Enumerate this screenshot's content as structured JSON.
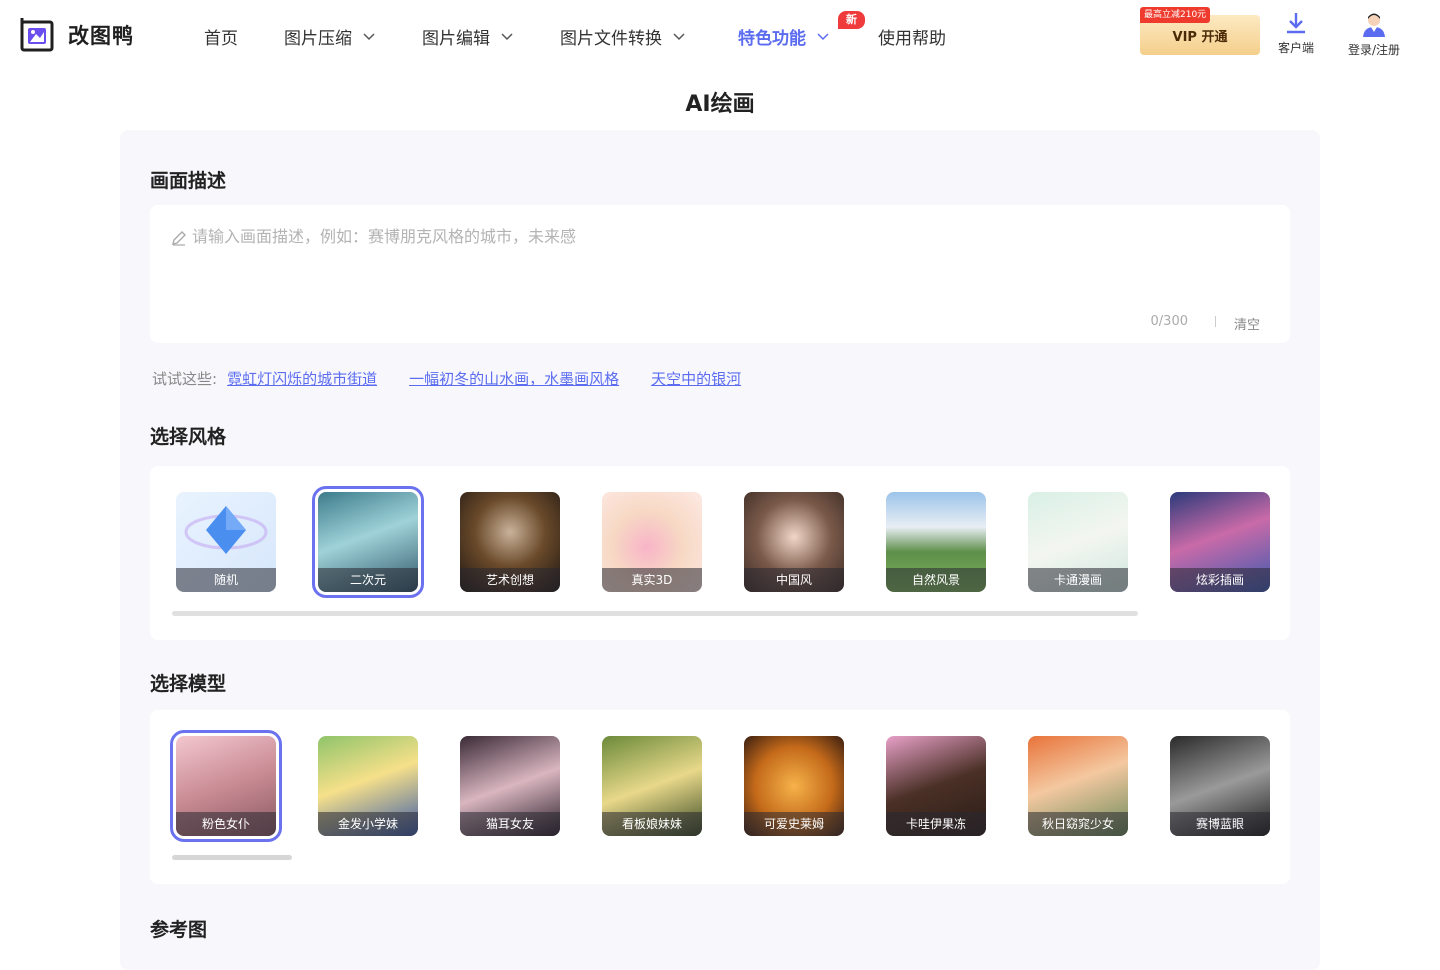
{
  "header": {
    "logo_text": "改图鸭",
    "nav": [
      {
        "label": "首页",
        "dropdown": false
      },
      {
        "label": "图片压缩",
        "dropdown": true
      },
      {
        "label": "图片编辑",
        "dropdown": true
      },
      {
        "label": "图片文件转换",
        "dropdown": true
      },
      {
        "label": "特色功能",
        "dropdown": true,
        "badge": "新",
        "active": true
      },
      {
        "label": "使用帮助",
        "dropdown": false
      }
    ],
    "vip_tag": "最高立减210元",
    "vip_label": "VIP 开通",
    "client_label": "客户端",
    "login_label": "登录/注册"
  },
  "page": {
    "title": "AI绘画",
    "description_section": "画面描述",
    "description_placeholder": "请输入画面描述，例如：赛博朋克风格的城市，未来感",
    "counter": "0/300",
    "clear_label": "清空",
    "try_label": "试试这些:",
    "suggestions": [
      "霓虹灯闪烁的城市街道",
      "一幅初冬的山水画，水墨画风格",
      "天空中的银河"
    ],
    "style_section": "选择风格",
    "styles": [
      {
        "label": "随机",
        "icon": "diamond-icon"
      },
      {
        "label": "二次元",
        "selected": true
      },
      {
        "label": "艺术创想"
      },
      {
        "label": "真实3D"
      },
      {
        "label": "中国风"
      },
      {
        "label": "自然风景"
      },
      {
        "label": "卡通漫画"
      },
      {
        "label": "炫彩插画"
      }
    ],
    "model_section": "选择模型",
    "models": [
      {
        "label": "粉色女仆",
        "selected": true
      },
      {
        "label": "金发小学妹"
      },
      {
        "label": "猫耳女友"
      },
      {
        "label": "看板娘妹妹"
      },
      {
        "label": "可爱史莱姆"
      },
      {
        "label": "卡哇伊果冻"
      },
      {
        "label": "秋日窈窕少女"
      },
      {
        "label": "赛博蓝眼"
      }
    ],
    "reference_section": "参考图"
  },
  "colors": {
    "accent": "#5b6cf0",
    "badge_red": "#ef3b3b",
    "panel_bg": "#f8f8fc"
  }
}
